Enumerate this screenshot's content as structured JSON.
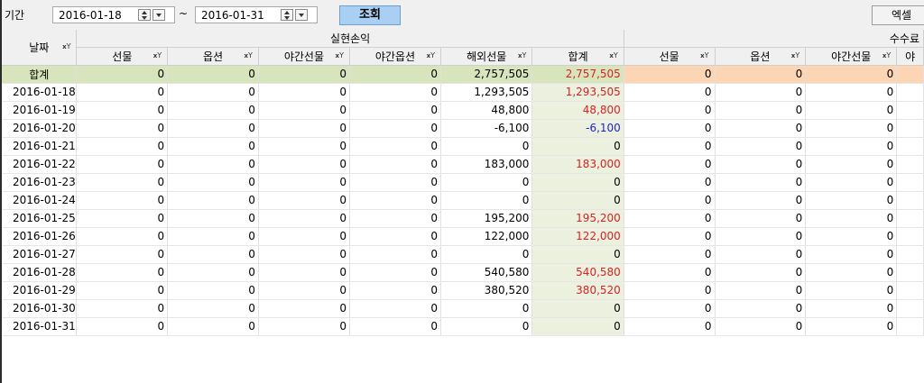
{
  "toolbar": {
    "period_label": "기간",
    "start_date": "2016-01-18",
    "tilde": "~",
    "end_date": "2016-01-31",
    "search_label": "조회",
    "excel_label": "엑셀",
    "search_button_color": "#a9cff2"
  },
  "grid": {
    "date_header": "날짜",
    "group_realized": "실현손익",
    "group_fee": "수수료",
    "columns": [
      "선물",
      "옵션",
      "야간선물",
      "야간옵션",
      "해외선물",
      "합계"
    ],
    "fee_columns": [
      "선물",
      "옵션",
      "야간선물",
      "야"
    ],
    "total_label": "합계",
    "total_row": [
      "0",
      "0",
      "0",
      "0",
      "2,757,505",
      "2,757,505",
      "0",
      "0",
      "0",
      ""
    ],
    "rows": [
      {
        "date": "2016-01-18",
        "values": [
          "0",
          "0",
          "0",
          "0",
          "1,293,505",
          "1,293,505",
          "0",
          "0",
          "0",
          ""
        ],
        "sum_color": "red"
      },
      {
        "date": "2016-01-19",
        "values": [
          "0",
          "0",
          "0",
          "0",
          "48,800",
          "48,800",
          "0",
          "0",
          "0",
          ""
        ],
        "sum_color": "red"
      },
      {
        "date": "2016-01-20",
        "values": [
          "0",
          "0",
          "0",
          "0",
          "-6,100",
          "-6,100",
          "0",
          "0",
          "0",
          ""
        ],
        "sum_color": "blue"
      },
      {
        "date": "2016-01-21",
        "values": [
          "0",
          "0",
          "0",
          "0",
          "0",
          "0",
          "0",
          "0",
          "0",
          ""
        ],
        "sum_color": "black"
      },
      {
        "date": "2016-01-22",
        "values": [
          "0",
          "0",
          "0",
          "0",
          "183,000",
          "183,000",
          "0",
          "0",
          "0",
          ""
        ],
        "sum_color": "red"
      },
      {
        "date": "2016-01-23",
        "values": [
          "0",
          "0",
          "0",
          "0",
          "0",
          "0",
          "0",
          "0",
          "0",
          ""
        ],
        "sum_color": "black"
      },
      {
        "date": "2016-01-24",
        "values": [
          "0",
          "0",
          "0",
          "0",
          "0",
          "0",
          "0",
          "0",
          "0",
          ""
        ],
        "sum_color": "black"
      },
      {
        "date": "2016-01-25",
        "values": [
          "0",
          "0",
          "0",
          "0",
          "195,200",
          "195,200",
          "0",
          "0",
          "0",
          ""
        ],
        "sum_color": "red"
      },
      {
        "date": "2016-01-26",
        "values": [
          "0",
          "0",
          "0",
          "0",
          "122,000",
          "122,000",
          "0",
          "0",
          "0",
          ""
        ],
        "sum_color": "red"
      },
      {
        "date": "2016-01-27",
        "values": [
          "0",
          "0",
          "0",
          "0",
          "0",
          "0",
          "0",
          "0",
          "0",
          ""
        ],
        "sum_color": "black"
      },
      {
        "date": "2016-01-28",
        "values": [
          "0",
          "0",
          "0",
          "0",
          "540,580",
          "540,580",
          "0",
          "0",
          "0",
          ""
        ],
        "sum_color": "red"
      },
      {
        "date": "2016-01-29",
        "values": [
          "0",
          "0",
          "0",
          "0",
          "380,520",
          "380,520",
          "0",
          "0",
          "0",
          ""
        ],
        "sum_color": "red"
      },
      {
        "date": "2016-01-30",
        "values": [
          "0",
          "0",
          "0",
          "0",
          "0",
          "0",
          "0",
          "0",
          "0",
          ""
        ],
        "sum_color": "black"
      },
      {
        "date": "2016-01-31",
        "values": [
          "0",
          "0",
          "0",
          "0",
          "0",
          "0",
          "0",
          "0",
          "0",
          ""
        ],
        "sum_color": "black"
      }
    ],
    "colors": {
      "total_row_bg": "#d8e4bc",
      "fee_total_bg": "#fcd5b4",
      "sum_col_bg": "#ebf1de",
      "positive": "#d62323",
      "negative": "#2323c8"
    }
  }
}
